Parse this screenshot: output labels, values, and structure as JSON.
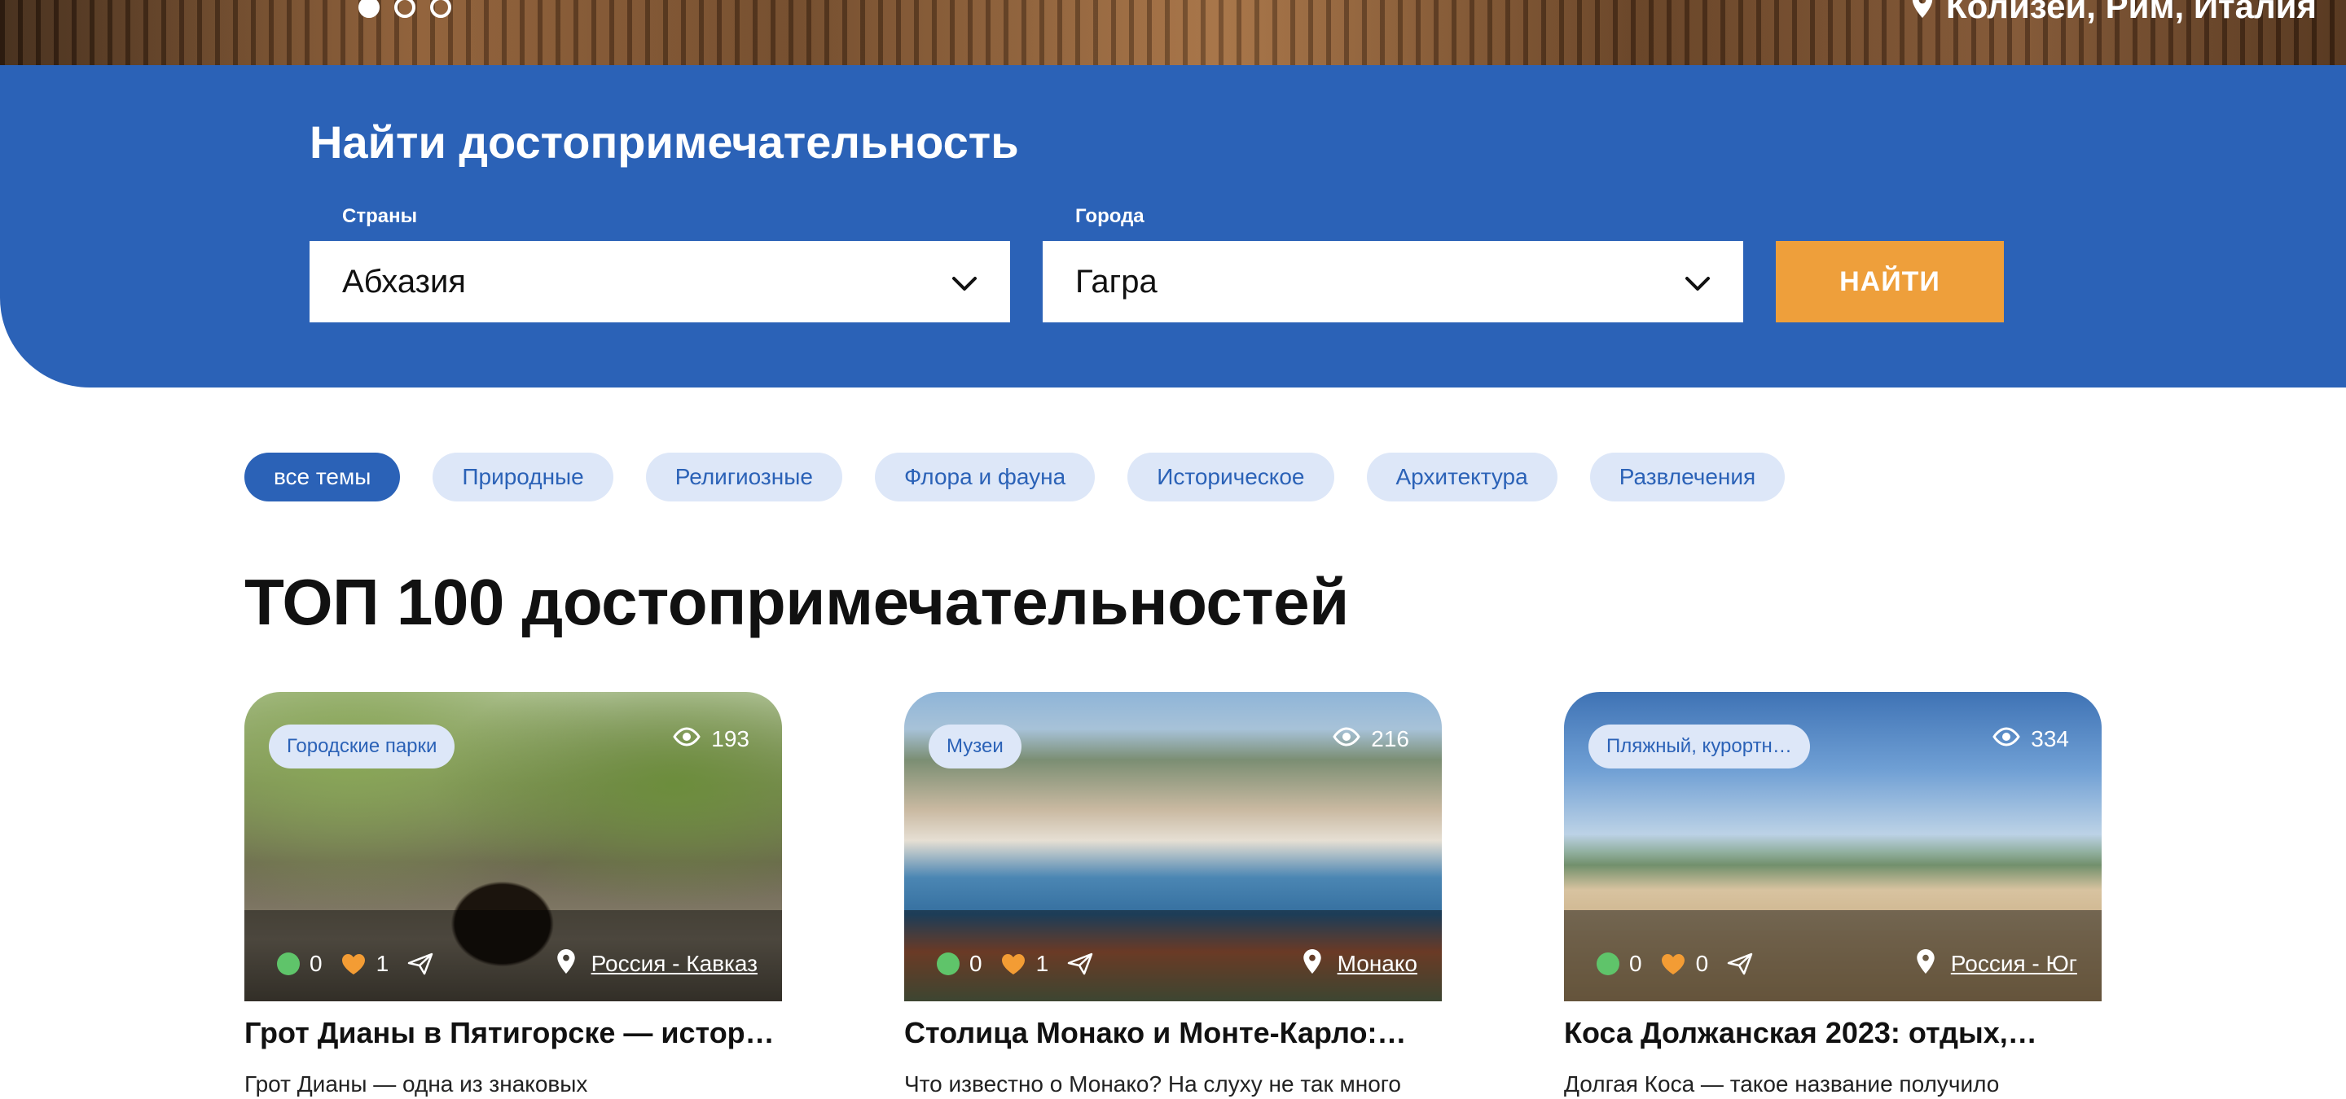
{
  "hero": {
    "location": "Колизей, Рим, Италия",
    "slides": 3,
    "active_slide": 1
  },
  "search": {
    "title": "Найти достопримечательность",
    "country_label": "Страны",
    "country_value": "Абхазия",
    "city_label": "Города",
    "city_value": "Гагра",
    "button_label": "НАЙТИ"
  },
  "filters": [
    {
      "label": "все темы",
      "active": true
    },
    {
      "label": "Природные",
      "active": false
    },
    {
      "label": "Религиозные",
      "active": false
    },
    {
      "label": "Флора и фауна",
      "active": false
    },
    {
      "label": "Историческое",
      "active": false
    },
    {
      "label": "Архитектура",
      "active": false
    },
    {
      "label": "Развлечения",
      "active": false
    }
  ],
  "section_title": "ТОП 100 достопримечательностей",
  "cards": [
    {
      "tag": "Городские парки",
      "views": "193",
      "comments": "0",
      "likes": "1",
      "location": "Россия - Кавказ",
      "title": "Грот Дианы в Пятигорске — история,…",
      "desc": "Грот Дианы — одна из знаковых"
    },
    {
      "tag": "Музеи",
      "views": "216",
      "comments": "0",
      "likes": "1",
      "location": "Монако",
      "title": "Столица Монако и Монте-Карло:…",
      "desc": "Что известно о Монако? На слуху не так много"
    },
    {
      "tag": "Пляжный, курортн…",
      "views": "334",
      "comments": "0",
      "likes": "0",
      "location": "Россия - Юг",
      "title": "Коса Должанская 2023: отдых,…",
      "desc": "Долгая Коса — такое название получило"
    }
  ],
  "colors": {
    "brand_blue": "#2b62b7",
    "chip_bg": "#dde7f8",
    "accent_orange": "#ee9f3b",
    "comment_green": "#5fc46a",
    "like_orange": "#f39c34"
  }
}
